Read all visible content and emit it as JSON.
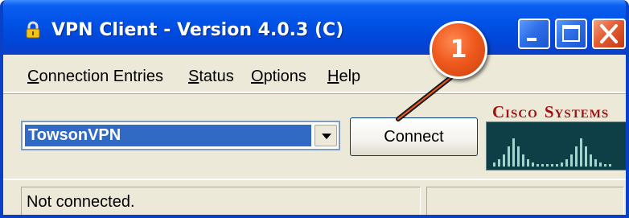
{
  "window": {
    "title": "VPN Client - Version 4.0.3 (C)"
  },
  "menu": {
    "items": [
      {
        "label": "Connection Entries"
      },
      {
        "label": "Status"
      },
      {
        "label": "Options"
      },
      {
        "label": "Help"
      }
    ]
  },
  "connection": {
    "selected_entry": "TowsonVPN",
    "connect_label": "Connect"
  },
  "logo": {
    "text": "Cisco Systems"
  },
  "status": {
    "text": "Not connected.",
    "secondary": ""
  },
  "callout": {
    "number": "1"
  },
  "colors": {
    "titlebar": "#0052e6",
    "selection": "#316ac5",
    "callout": "#f05a1e",
    "cisco_text": "#a01010",
    "cisco_bg": "#0e3e46"
  },
  "icons": [
    "lock-icon",
    "minimize-icon",
    "maximize-icon",
    "close-icon",
    "dropdown-arrow-icon"
  ]
}
